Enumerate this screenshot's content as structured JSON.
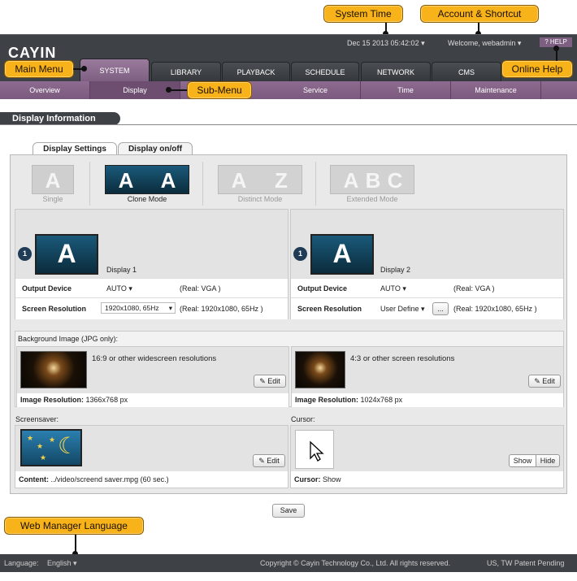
{
  "callouts": {
    "system_time": "System Time",
    "account_shortcut": "Account & Shortcut",
    "main_menu": "Main Menu",
    "sub_menu": "Sub-Menu",
    "online_help": "Online Help",
    "web_manager_language": "Web Manager Language"
  },
  "header": {
    "logo": "CAYIN",
    "datetime": "Dec 15 2013 05:42:02",
    "welcome": "Welcome, webadmin",
    "help": "HELP"
  },
  "nav": {
    "tabs": [
      "SYSTEM",
      "LIBRARY",
      "PLAYBACK",
      "SCHEDULE",
      "NETWORK",
      "CMS"
    ],
    "active": "SYSTEM"
  },
  "submenu": {
    "items": [
      "Overview",
      "Display",
      "Service",
      "Time",
      "Maintenance"
    ],
    "active": "Display"
  },
  "section_title": "Display Information",
  "tabs": {
    "settings": "Display Settings",
    "onoff": "Display on/off"
  },
  "modes": {
    "single": "Single",
    "clone": "Clone Mode",
    "distinct": "Distinct Mode",
    "extended": "Extended Mode",
    "letters": {
      "a": "A",
      "z": "Z",
      "b": "B",
      "c": "C"
    }
  },
  "display1": {
    "badge": "1",
    "name": "Display 1",
    "output_label": "Output Device",
    "output_value": "AUTO",
    "output_real": "(Real: VGA )",
    "res_label": "Screen Resolution",
    "res_value": "1920x1080, 65Hz",
    "res_real": "(Real: 1920x1080, 65Hz )"
  },
  "display2": {
    "badge": "1",
    "name": "Display 2",
    "output_label": "Output Device",
    "output_value": "AUTO",
    "output_real": "(Real: VGA )",
    "res_label": "Screen Resolution",
    "res_value": "User Define",
    "res_more": "...",
    "res_real": "(Real: 1920x1080, 65Hz )"
  },
  "background": {
    "title": "Background Image (JPG only):",
    "wide_desc": "16:9 or other widescreen resolutions",
    "wide_res_label": "Image Resolution:",
    "wide_res_value": "1366x768 px",
    "std_desc": "4:3 or other screen resolutions",
    "std_res_label": "Image Resolution:",
    "std_res_value": "1024x768 px",
    "edit": "Edit"
  },
  "screensaver": {
    "title": "Screensaver:",
    "content_label": "Content:",
    "content_value": "../video/screend saver.mpg (60 sec.)",
    "edit": "Edit"
  },
  "cursor": {
    "title": "Cursor:",
    "label": "Cursor:",
    "value": "Show",
    "show": "Show",
    "hide": "Hide"
  },
  "save": "Save",
  "footer": {
    "language_label": "Language:",
    "language_value": "English",
    "copyright": "Copyright © Cayin Technology Co., Ltd. All rights reserved.",
    "patent": "US, TW Patent Pending"
  },
  "colors": {
    "accent": "#f8b21a",
    "nav": "#3e4247",
    "submenu": "#8e6b90"
  }
}
